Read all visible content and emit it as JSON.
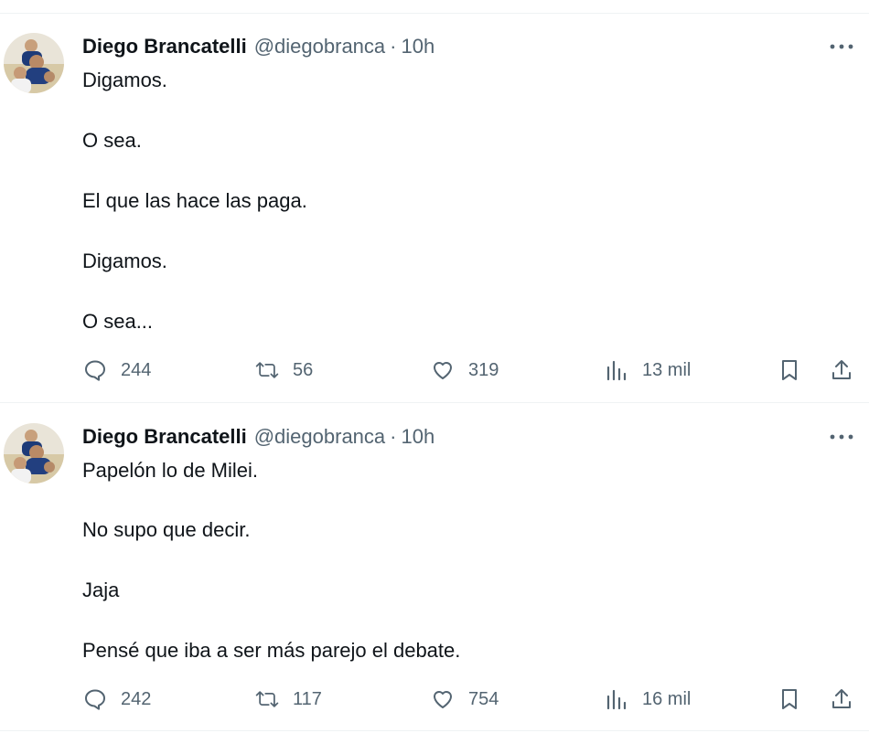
{
  "tweets": [
    {
      "author": {
        "name": "Diego Brancatelli",
        "handle": "@diegobranca"
      },
      "separator": "·",
      "time": "10h",
      "lines": [
        "Digamos.",
        "O sea.",
        "El que las hace las paga.",
        "Digamos.",
        "O sea..."
      ],
      "stats": {
        "replies": "244",
        "retweets": "56",
        "likes": "319",
        "views": "13 mil"
      }
    },
    {
      "author": {
        "name": "Diego Brancatelli",
        "handle": "@diegobranca"
      },
      "separator": "·",
      "time": "10h",
      "lines": [
        "Papelón lo de Milei.",
        "No supo que decir.",
        "Jaja",
        "Pensé que iba a ser más parejo el debate."
      ],
      "stats": {
        "replies": "242",
        "retweets": "117",
        "likes": "754",
        "views": "16 mil"
      }
    }
  ],
  "icons": {
    "more": "more-horizontal-icon",
    "reply": "reply-bubble-icon",
    "retweet": "retweet-icon",
    "like": "heart-icon",
    "views": "analytics-bars-icon",
    "bookmark": "bookmark-icon",
    "share": "share-upload-icon"
  },
  "colors": {
    "text": "#0f1419",
    "secondary": "#536471",
    "divider": "#eff3f4"
  }
}
